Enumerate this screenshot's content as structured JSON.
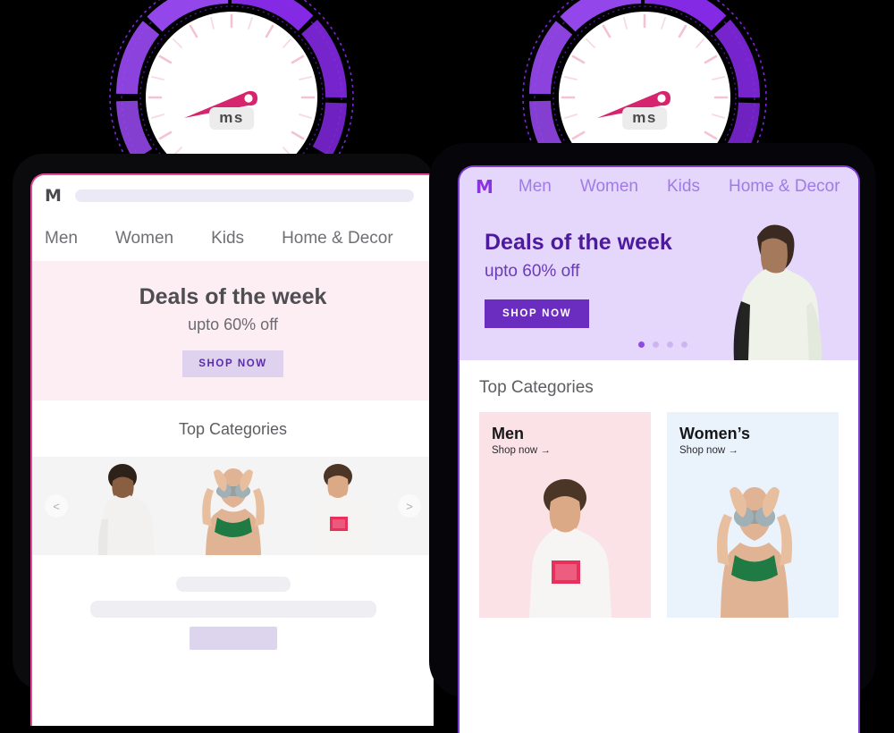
{
  "gauge": {
    "unit_label": "ms",
    "needle_color": "#d6246e",
    "arc_color": "#8b2bf0",
    "arc_color_light": "#9b4af5",
    "dial_color": "#ffffff",
    "tick_color": "#f3c3d5",
    "count": 2
  },
  "mobile": {
    "logo": "M",
    "search_placeholder": "",
    "nav": [
      "Men",
      "Women",
      "Kids",
      "Home & Decor"
    ],
    "hero": {
      "title": "Deals of the week",
      "subtitle": "upto 60% off",
      "cta": "SHOP NOW",
      "bg": "#fdeef3"
    },
    "categories_title": "Top Categories",
    "carousel": {
      "prev": "<",
      "next": ">",
      "items": [
        "man-white-tshirt",
        "woman-green-top",
        "man-outcast-tshirt"
      ]
    },
    "skeleton_rows": 3
  },
  "tablet": {
    "logo": "M",
    "nav": [
      "Men",
      "Women",
      "Kids",
      "Home & Decor"
    ],
    "hero": {
      "title": "Deals of the week",
      "subtitle": "upto 60% off",
      "cta": "SHOP NOW",
      "bg": "#e4d7fb",
      "dots_total": 4,
      "dot_active_index": 0
    },
    "categories_title": "Top Categories",
    "cards": [
      {
        "title": "Men",
        "link": "Shop now →",
        "bg": "#fbe2e6",
        "image": "man-outcast-tshirt"
      },
      {
        "title": "Women’s",
        "link": "Shop now →",
        "bg": "#eaf2fc",
        "image": "woman-green-top"
      }
    ]
  },
  "colors": {
    "background": "#000000",
    "brand_purple": "#8a33e0",
    "brand_pink": "#e24a9a",
    "deep_purple": "#4d1a9e"
  }
}
